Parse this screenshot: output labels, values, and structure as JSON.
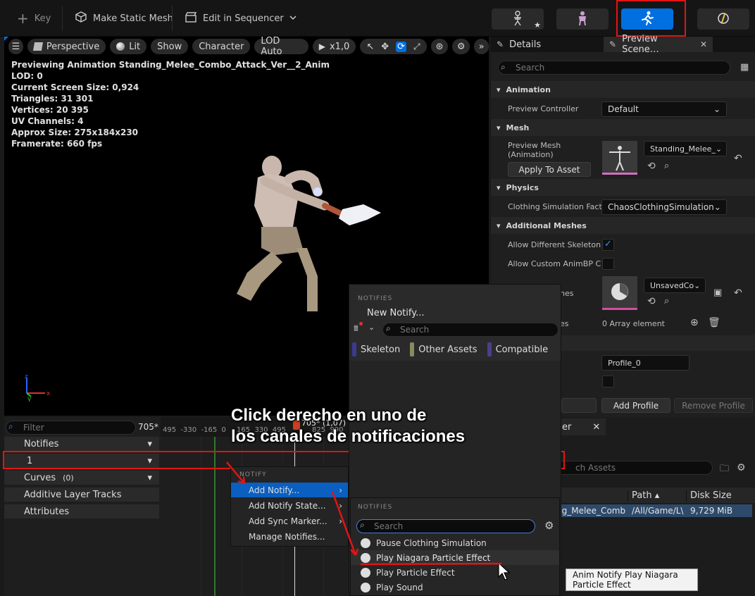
{
  "toolbar": {
    "key_label": "Key",
    "static_mesh_label": "Make Static Mesh",
    "sequencer_label": "Edit in Sequencer"
  },
  "viewport": {
    "perspective": "Perspective",
    "lit": "Lit",
    "show": "Show",
    "character": "Character",
    "lod": "LOD Auto",
    "speed": "x1,0",
    "info": [
      "Previewing Animation Standing_Melee_Combo_Attack_Ver__2_Anim",
      "LOD: 0",
      "Current Screen Size: 0,924",
      "Triangles: 31 301",
      "Vertices: 20 395",
      "UV Channels: 4",
      "Approx Size: 275x184x230",
      "Framerate: 660 fps"
    ]
  },
  "details": {
    "tab_details": "Details",
    "tab_preview": "Preview Scene…",
    "search_placeholder": "Search",
    "sections": {
      "animation": "Animation",
      "mesh": "Mesh",
      "physics": "Physics",
      "additional": "Additional Meshes"
    },
    "preview_controller_label": "Preview Controller",
    "preview_controller_value": "Default",
    "preview_mesh_label": "Preview Mesh\n(Animation)",
    "preview_mesh_value": "Standing_Melee_",
    "apply_to_asset": "Apply To Asset",
    "clothing_label": "Clothing Simulation Fact",
    "clothing_value": "ChaosClothingSimulation",
    "allow_diff_skeleton": "Allow Different Skeleton",
    "allow_custom_animbp": "Allow Custom AnimBP C",
    "meshes_label_tail": "hes",
    "es_tail": "es",
    "unsaved_value": "UnsavedCo",
    "array_elements": "0 Array element",
    "profile_value": "Profile_0",
    "add_profile": "Add Profile",
    "remove_profile": "Remove Profile"
  },
  "content_browser": {
    "tab_tail": "er",
    "search_placeholder": "ch Assets",
    "col_path": "Path",
    "col_disk": "Disk Size",
    "row_name": "ng_Melee_Comb",
    "row_path": "/All/Game/L\\",
    "row_size": "9,729 MiB"
  },
  "timeline": {
    "filter_placeholder": "Filter",
    "frame_readout": "705*",
    "ruler_left": "495  -330  -165  0",
    "ruler_right": "165  330  495",
    "ruler_tail": "825  990",
    "marker_label": "705* (1,07)",
    "tracks": {
      "notifies": "Notifies",
      "one": "1",
      "curves": "Curves",
      "curves_count": "(0)",
      "additive": "Additive Layer Tracks",
      "attributes": "Attributes"
    }
  },
  "notify_popup": {
    "header": "NOTIFIES",
    "new_notify": "New Notify...",
    "search_placeholder": "Search",
    "filter_skeleton": "Skeleton",
    "filter_other": "Other Assets",
    "filter_compatible": "Compatible"
  },
  "context_menu": {
    "header": "NOTIFY",
    "items": [
      "Add Notify...",
      "Add Notify State...",
      "Add Sync Marker...",
      "Manage Notifies..."
    ]
  },
  "submenu": {
    "header": "NOTIFIES",
    "search_placeholder": "Search",
    "items": [
      "Pause Clothing Simulation",
      "Play Niagara Particle Effect",
      "Play Particle Effect",
      "Play Sound"
    ]
  },
  "tooltip": "Anim Notify Play Niagara Particle Effect",
  "caption": [
    "Click derecho en uno de",
    "los canales de notificaciones"
  ],
  "colors": {
    "accent_blue": "#0070e0",
    "annotation_red": "#e01515",
    "skeleton_chip": "#3b3b8f",
    "other_chip": "#8a8a60",
    "compatible_chip": "#4a3f8a"
  }
}
